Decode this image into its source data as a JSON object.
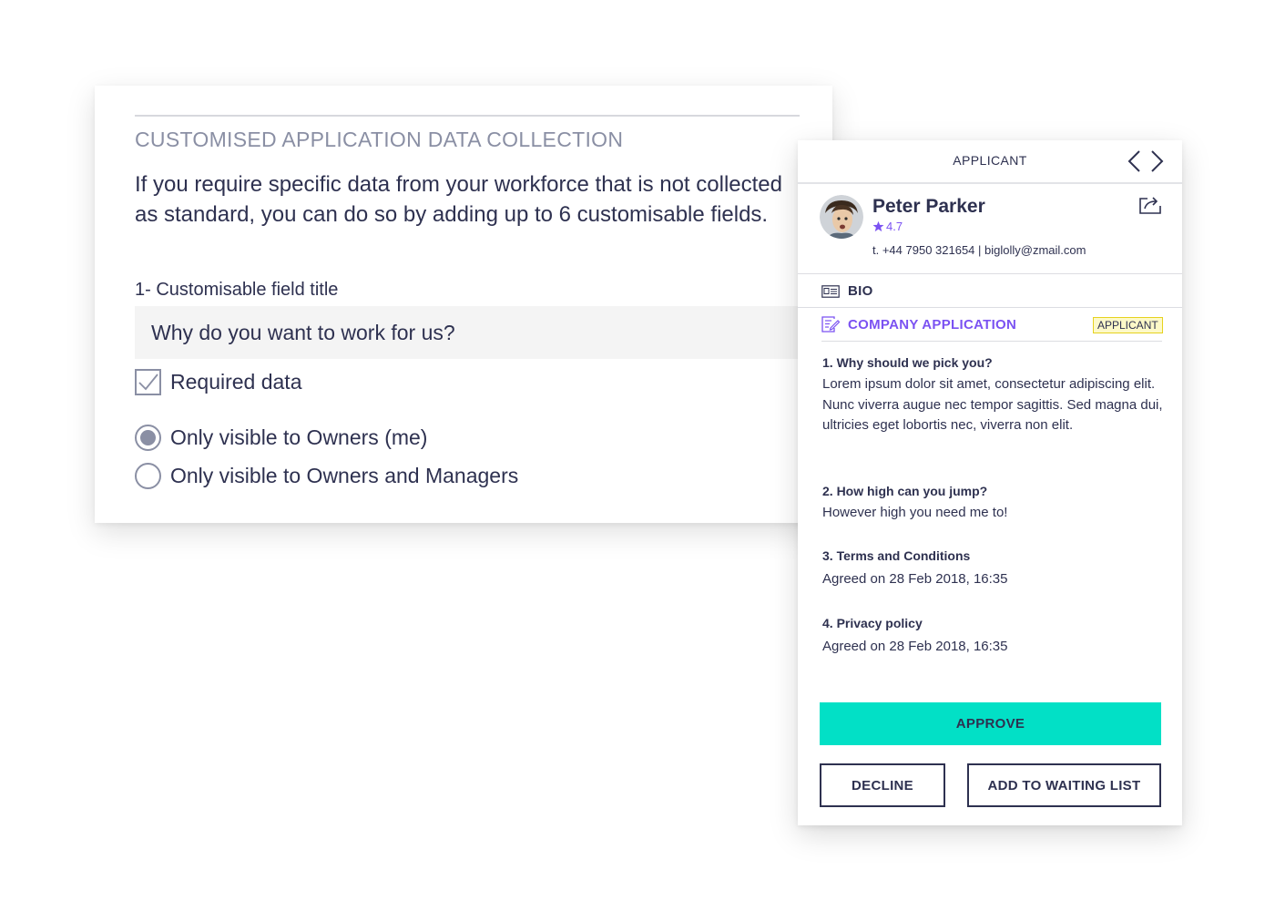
{
  "settings_card": {
    "heading": "CUSTOMISED APPLICATION DATA COLLECTION",
    "intro": "If you require specific data from your workforce that is not collected as standard, you can do so by adding up to 6 customisable fields.",
    "field_label": "1- Customisable field title",
    "field_value": "Why do you want to work for us?",
    "required_checkbox": {
      "label": "Required data",
      "checked": true
    },
    "visibility_options": [
      {
        "label": "Only visible to Owners (me)",
        "selected": true
      },
      {
        "label": "Only visible to Owners and Managers",
        "selected": false
      }
    ]
  },
  "applicant_panel": {
    "title": "APPLICANT",
    "prev_icon": "chevron-left-icon",
    "next_icon": "chevron-right-icon",
    "name": "Peter Parker",
    "rating": "4.7",
    "contact": "t. +44 7950 321654 | biglolly@zmail.com",
    "bio_label": "BIO",
    "company_label": "COMPANY APPLICATION",
    "status_badge": "APPLICANT",
    "questions": [
      {
        "question": "1. Why should we pick you?",
        "answer": "Lorem ipsum dolor sit amet, consectetur adipiscing elit. Nunc viverra augue nec tempor sagittis. Sed magna dui, ultricies eget lobortis nec, viverra non elit."
      },
      {
        "question": "2. How high can you jump?",
        "answer": "However high you need me to!"
      },
      {
        "question": "3. Terms and Conditions",
        "answer": "Agreed on 28 Feb 2018, 16:35"
      },
      {
        "question": "4. Privacy policy",
        "answer": "Agreed on 28 Feb 2018, 16:35"
      }
    ],
    "approve_label": "APPROVE",
    "decline_label": "DECLINE",
    "waiting_label": "ADD TO WAITING LIST"
  },
  "colors": {
    "text": "#2e3150",
    "muted": "#8a8fa4",
    "accent_purple": "#7b52f2",
    "approve_teal": "#02e0c6",
    "badge_yellow": "#fdf9c8"
  }
}
